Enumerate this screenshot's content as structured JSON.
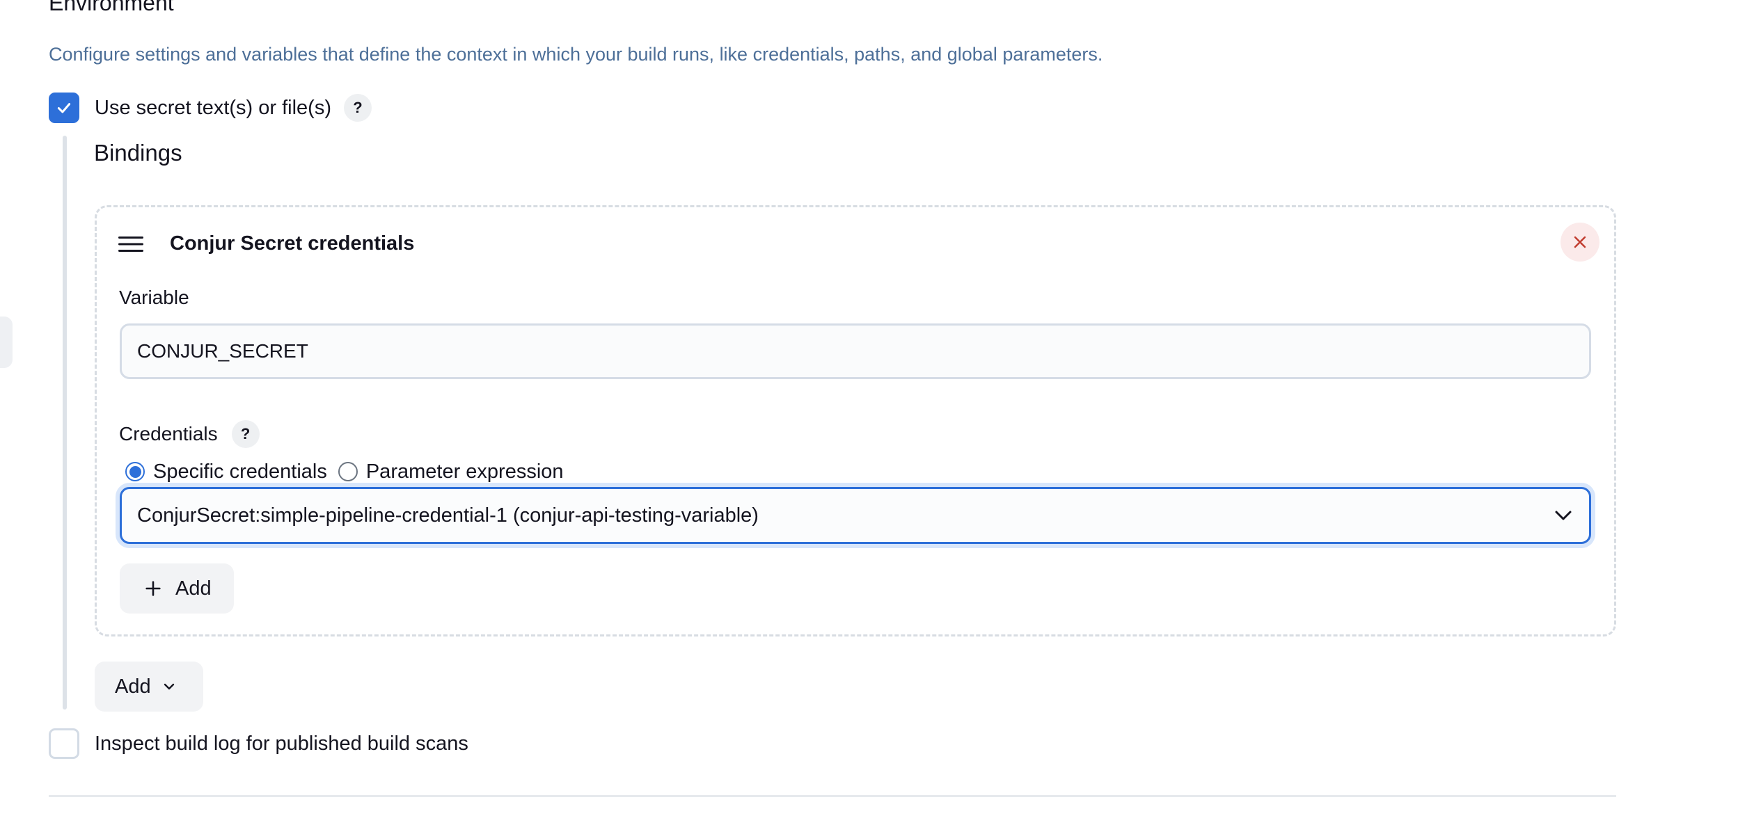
{
  "section": {
    "title": "Environment",
    "description": "Configure settings and variables that define the context in which your build runs, like credentials, paths, and global parameters."
  },
  "secret_option": {
    "label": "Use secret text(s) or file(s)",
    "checked": true,
    "help": "?"
  },
  "bindings": {
    "title": "Bindings",
    "card": {
      "title": "Conjur Secret credentials",
      "variable": {
        "label": "Variable",
        "value": "CONJUR_SECRET"
      },
      "credentials": {
        "label": "Credentials",
        "help": "?",
        "options": [
          {
            "label": "Specific credentials",
            "selected": true
          },
          {
            "label": "Parameter expression",
            "selected": false
          }
        ],
        "selected_value": "ConjurSecret:simple-pipeline-credential-1 (conjur-api-testing-variable)",
        "add_label": "Add"
      }
    },
    "add_label": "Add"
  },
  "inspect_option": {
    "label": "Inspect build log for published build scans",
    "checked": false
  },
  "colors": {
    "accent": "#2d6fd9",
    "description_text": "#4d6f98",
    "close_icon": "#c0392b"
  },
  "icons": {
    "check": "check-icon",
    "handle": "drag-handle-icon",
    "close": "close-icon",
    "chevron": "chevron-down-icon",
    "plus": "plus-icon"
  }
}
